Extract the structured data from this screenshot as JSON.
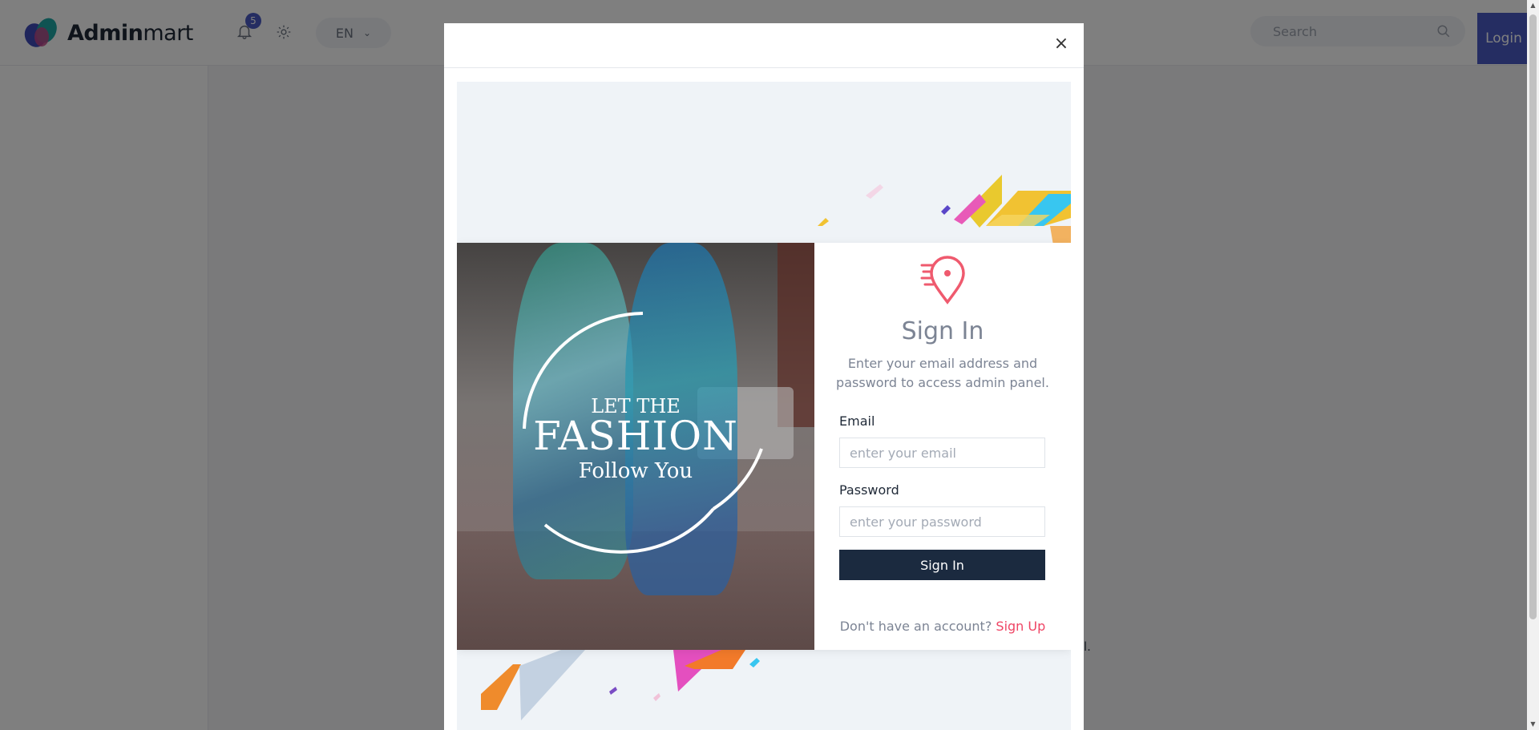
{
  "brand": {
    "name_bold": "Admin",
    "name_rest": "mart"
  },
  "header": {
    "notifications_count": "5",
    "language": "EN",
    "search_placeholder": "Search",
    "login_label": "Login"
  },
  "background": {
    "footer_fragment": "l."
  },
  "modal": {
    "close_symbol": "×",
    "promo": {
      "line1": "LET THE",
      "line2": "FASHION",
      "line3": "Follow You"
    },
    "signin": {
      "title": "Sign In",
      "subtitle": "Enter your email address and password to access admin panel.",
      "email_label": "Email",
      "email_placeholder": "enter your email",
      "password_label": "Password",
      "password_placeholder": "enter your password",
      "submit_label": "Sign In",
      "signup_prompt": "Don't have an account?",
      "signup_link": "Sign Up"
    }
  },
  "colors": {
    "primary": "#4b5bc4",
    "dark_button": "#1b2a3f",
    "accent_pink": "#ef4565"
  }
}
